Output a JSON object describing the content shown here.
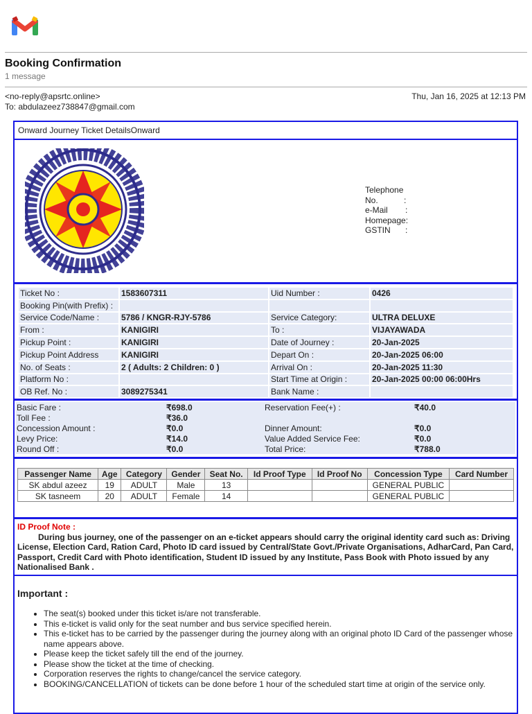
{
  "email": {
    "subject": "Booking Confirmation",
    "message_count": "1 message",
    "from": "<no-reply@apsrtc.online>",
    "to": "To: abdulazeez738847@gmail.com",
    "date": "Thu, Jan 16, 2025 at 12:13 PM"
  },
  "ticket": {
    "title": "Onward Journey Ticket DetailsOnward",
    "contact": [
      {
        "label": "Telephone No.",
        "sep": ":"
      },
      {
        "label": "e-Mail",
        "sep": ":"
      },
      {
        "label": "Homepage:",
        "sep": ""
      },
      {
        "label": "GSTIN",
        "sep": ":"
      }
    ],
    "details": [
      [
        "Ticket No :",
        "1583607311",
        "Uid Number :",
        "0426"
      ],
      [
        "Booking Pin(with Prefix) :",
        "",
        "",
        ""
      ],
      [
        "Service Code/Name :",
        "5786 / KNGR-RJY-5786",
        "Service Category:",
        "ULTRA DELUXE"
      ],
      [
        "From :",
        "KANIGIRI",
        "To :",
        "VIJAYAWADA"
      ],
      [
        "Pickup Point :",
        "KANIGIRI",
        "Date of Journey :",
        "20-Jan-2025"
      ],
      [
        "Pickup Point Address",
        "KANIGIRI",
        "Depart On :",
        "20-Jan-2025 06:00"
      ],
      [
        "No. of Seats :",
        "2 ( Adults: 2   Children: 0 )",
        "Arrival On :",
        "20-Jan-2025 11:30"
      ],
      [
        "Platform No :",
        "",
        "Start Time at Origin :",
        "20-Jan-2025 00:00 06:00Hrs"
      ],
      [
        "OB Ref. No :",
        "3089275341",
        "Bank Name :",
        ""
      ]
    ],
    "fares": [
      [
        "Basic Fare :",
        "₹698.0",
        "Reservation Fee(+) :",
        "₹40.0"
      ],
      [
        "Toll Fee :",
        "₹36.0",
        "",
        ""
      ],
      [
        "Concession Amount :",
        "₹0.0",
        "Dinner Amount:",
        "₹0.0"
      ],
      [
        "Levy Price:",
        "₹14.0",
        "Value Added Service Fee:",
        "₹0.0"
      ],
      [
        "Round Off :",
        "₹0.0",
        "Total Price:",
        "₹788.0"
      ]
    ],
    "passenger_headers": [
      "Passenger Name",
      "Age",
      "Category",
      "Gender",
      "Seat No.",
      "Id Proof Type",
      "Id Proof No",
      "Concession Type",
      "Card Number"
    ],
    "passengers": [
      [
        "SK abdul azeez",
        "19",
        "ADULT",
        "Male",
        "13",
        "",
        "",
        "GENERAL PUBLIC",
        ""
      ],
      [
        "SK tasneem",
        "20",
        "ADULT",
        "Female",
        "14",
        "",
        "",
        "GENERAL PUBLIC",
        ""
      ]
    ],
    "id_note_label": "ID Proof Note :",
    "id_note": "During bus journey, one of the passenger on an e-ticket appears should carry the original identity card such as: Driving License, Election Card, Ration Card, Photo ID card issued by Central/State Govt./Private Organisations, AdharCard, Pan Card, Passport, Credit Card with Photo identification, Student ID issued by any Institute, Pass Book with Photo issued by any Nationalised Bank .",
    "important_title": "Important :",
    "important": [
      "The seat(s) booked under this ticket is/are not transferable.",
      "This e-ticket is valid only for the seat number and bus service specified herein.",
      "This e-ticket has to be carried by the passenger during the journey along with an original photo ID Card of the passenger whose name appears above.",
      "Please keep the ticket safely till the end of the journey.",
      "Please show the ticket at the time of checking.",
      "Corporation reserves the rights to change/cancel the service category.",
      "BOOKING/CANCELLATION of tickets can be done before 1 hour of the scheduled start time at origin of the service only."
    ]
  },
  "logo_text": "APSRTC"
}
